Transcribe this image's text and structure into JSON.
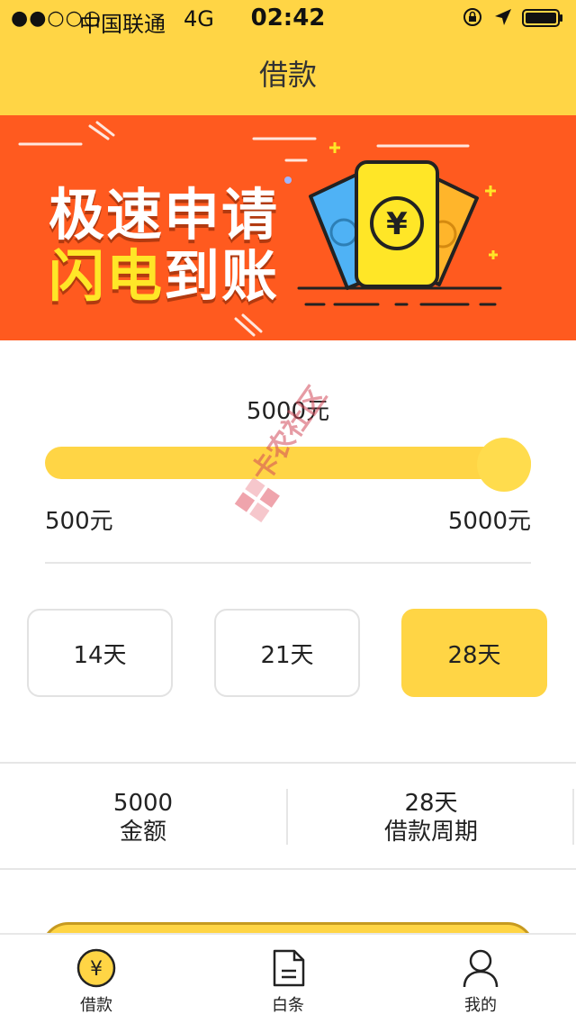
{
  "status_bar": {
    "signal": "●●○○○",
    "carrier": "中国联通",
    "network": "4G",
    "time": "02:42"
  },
  "header": {
    "title": "借款"
  },
  "banner": {
    "line1": "极速申请",
    "line2_highlight": "闪电",
    "line2_rest": "到账",
    "ticket_symbol": "¥"
  },
  "loan": {
    "current_amount": "5000元",
    "min_label": "500元",
    "max_label": "5000元",
    "slider_value": 1.0,
    "periods": [
      {
        "label": "14天",
        "selected": false
      },
      {
        "label": "21天",
        "selected": false
      },
      {
        "label": "28天",
        "selected": true
      }
    ]
  },
  "summary": {
    "amount_value": "5000",
    "amount_label": "金额",
    "period_value": "28天",
    "period_label": "借款周期"
  },
  "watermark": {
    "text": "卡农社区"
  },
  "tabbar": {
    "items": [
      {
        "label": "借款",
        "icon": "yen-coin-icon",
        "active": true
      },
      {
        "label": "白条",
        "icon": "document-icon",
        "active": false
      },
      {
        "label": "我的",
        "icon": "user-icon",
        "active": false
      }
    ]
  },
  "colors": {
    "brand_yellow": "#FFD545",
    "banner_orange": "#FF5A1F",
    "highlight_yellow": "#FFE627"
  }
}
